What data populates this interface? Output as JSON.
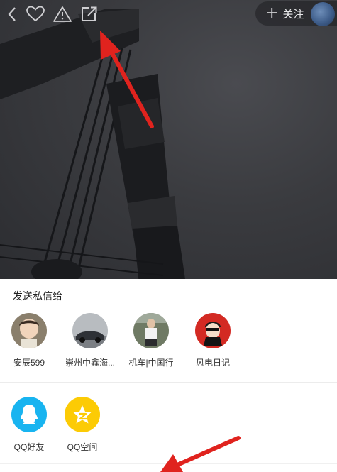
{
  "topbar": {
    "icons": [
      "back-icon",
      "heart-icon",
      "warning-icon",
      "share-icon"
    ],
    "follow_label": "关注"
  },
  "share_sheet": {
    "section_title": "发送私信给",
    "contacts": [
      {
        "name": "安辰599"
      },
      {
        "name": "崇州中鑫海..."
      },
      {
        "name": "机车|中国行"
      },
      {
        "name": "风电日记"
      }
    ],
    "apps": [
      {
        "name": "QQ好友",
        "icon": "qq-icon",
        "color": "#18b4f0"
      },
      {
        "name": "QQ空间",
        "icon": "qzone-star-icon",
        "color": "#fccb05"
      }
    ]
  },
  "annotation": {
    "color": "#e0231e"
  }
}
